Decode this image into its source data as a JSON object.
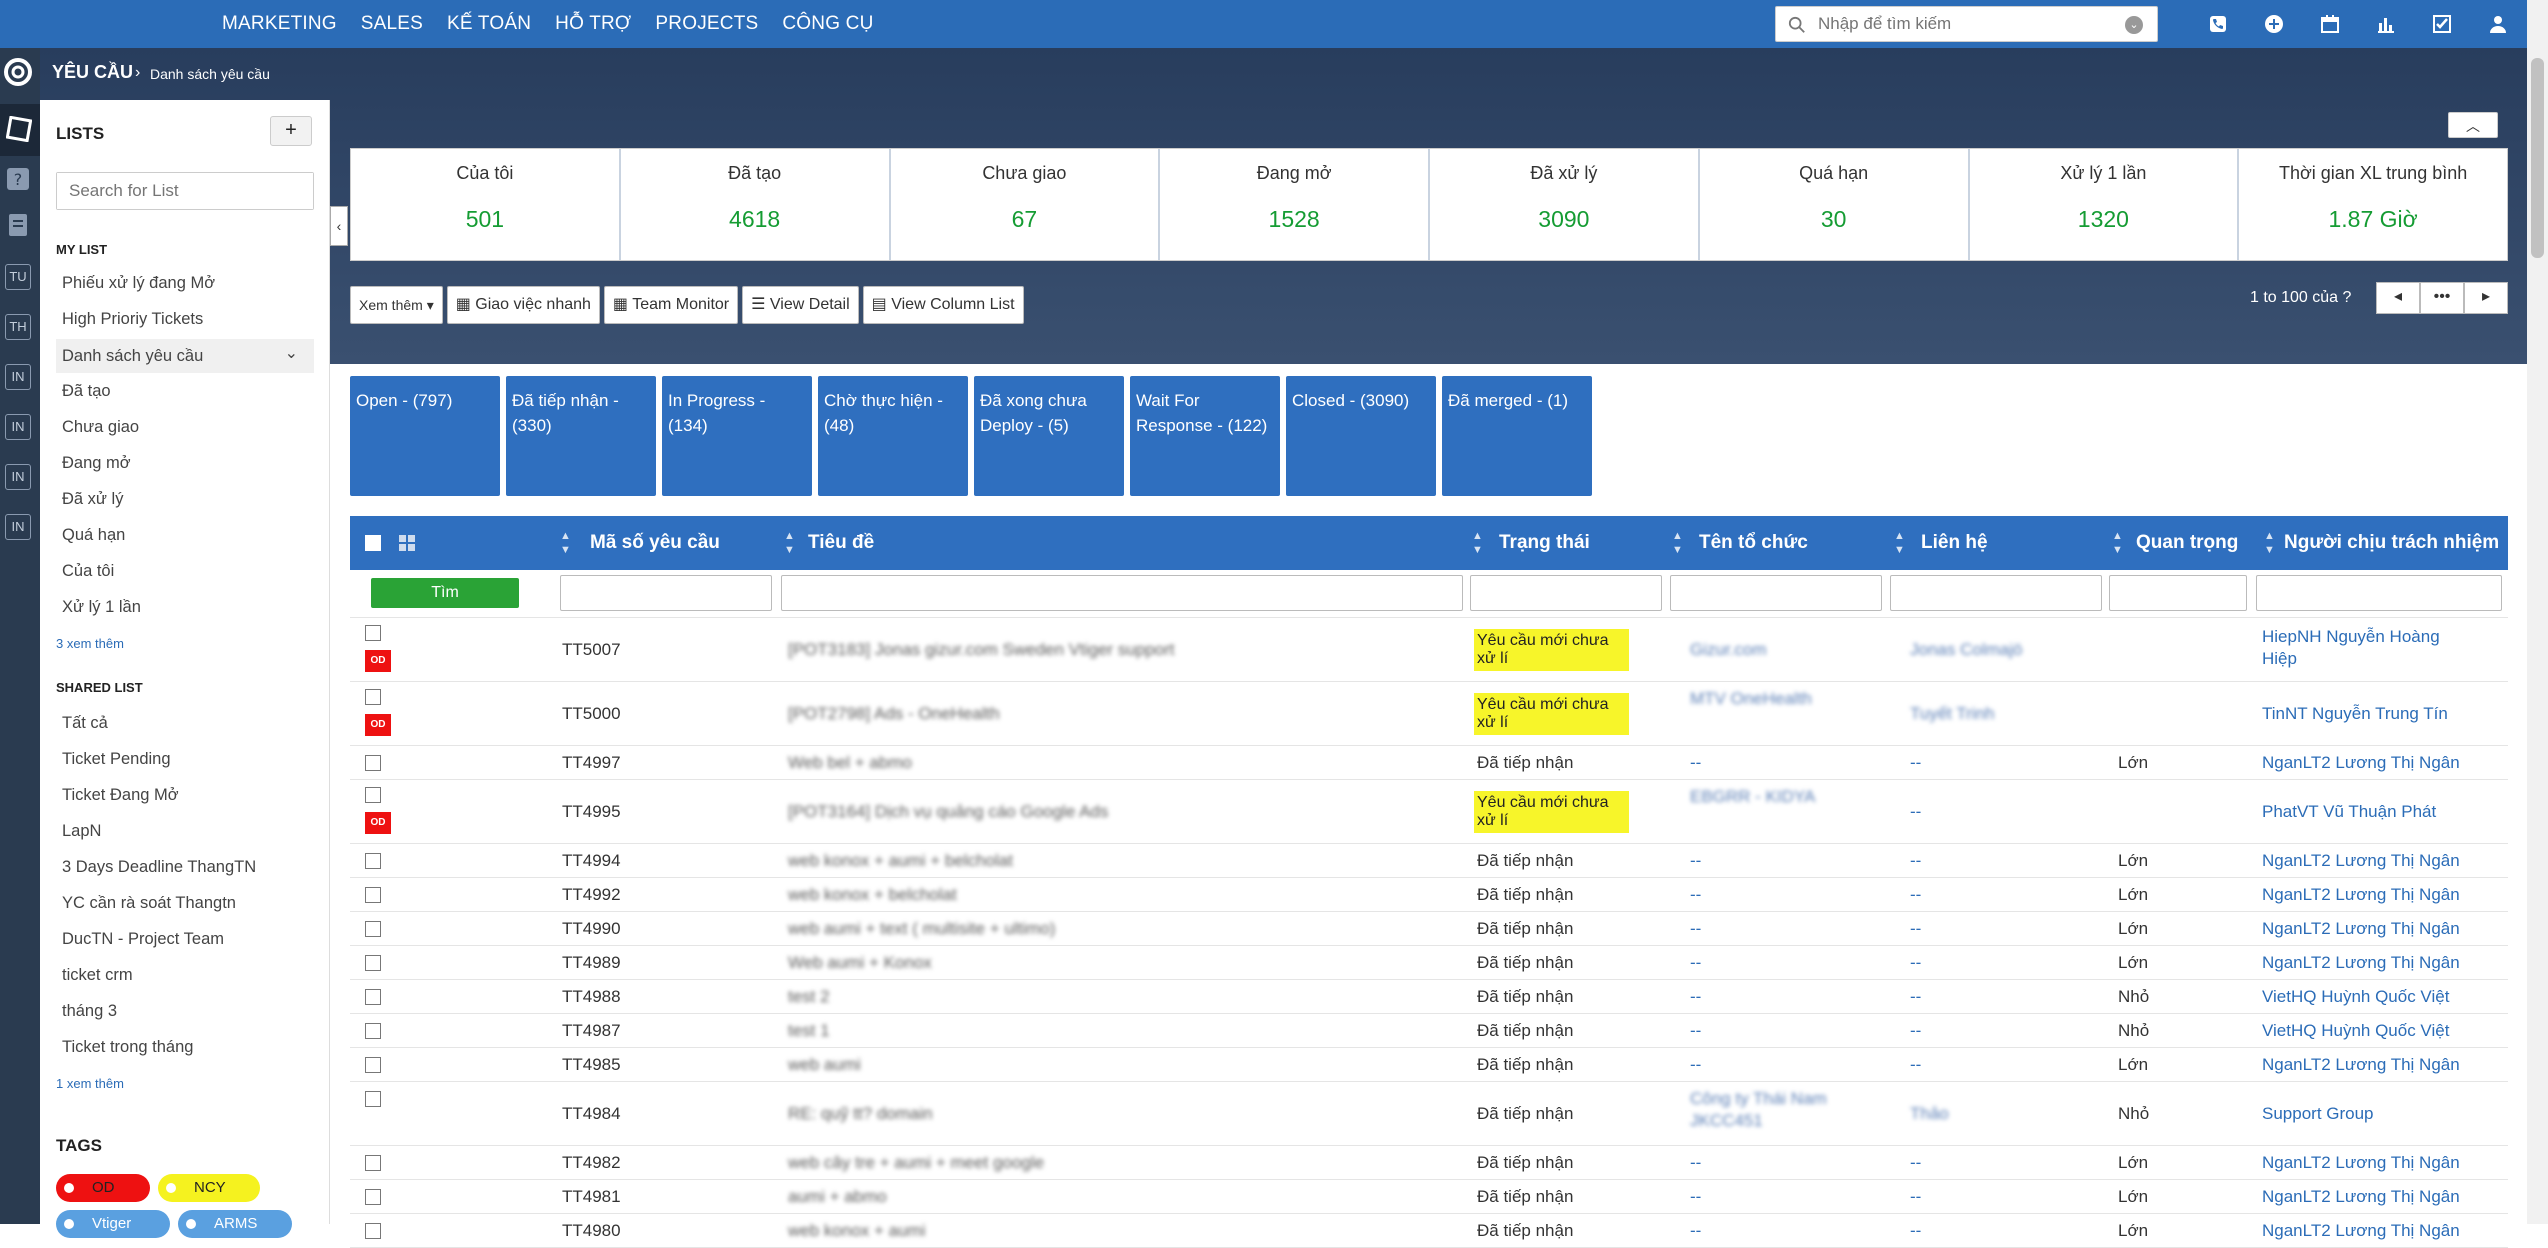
{
  "topnav": [
    "MARKETING",
    "SALES",
    "KẾ TOÁN",
    "HỖ TRỢ",
    "PROJECTS",
    "CÔNG CỤ"
  ],
  "search": {
    "placeholder": "Nhập để tìm kiếm"
  },
  "breadcrumb": {
    "section": "YÊU CẦU",
    "page": "Danh sách yêu cầu"
  },
  "leftrail": [
    "TU",
    "TH",
    "IN",
    "IN",
    "IN",
    "IN"
  ],
  "lists": {
    "title": "LISTS",
    "add": "+",
    "search_placeholder": "Search for List",
    "my_list_title": "MY LIST",
    "my_list": [
      "Phiếu xử lý đang Mở",
      "High Prioriy Tickets",
      "Danh sách yêu cầu",
      "Đã tạo",
      "Chưa giao",
      "Đang mở",
      "Đã xử lý",
      "Quá hạn",
      "Của tôi",
      "Xử lý 1 lần"
    ],
    "my_more": "3 xem thêm",
    "shared_title": "SHARED LIST",
    "shared_list": [
      "Tất cả",
      "Ticket Pending",
      "Ticket Đang Mở",
      "LapN",
      "3 Days Deadline ThangTN",
      "YC cần rà soát Thangtn",
      "DucTN - Project Team",
      "ticket crm",
      "tháng 3",
      "Ticket trong tháng"
    ],
    "shared_more": "1 xem thêm",
    "tags_title": "TAGS",
    "tags": [
      {
        "label": "OD",
        "color": "#ee1111"
      },
      {
        "label": "NCY",
        "color": "#f5f21f"
      },
      {
        "label": "Vtiger",
        "color": "#5aa0e0"
      },
      {
        "label": "ARMS",
        "color": "#5aa0e0"
      }
    ]
  },
  "stats": [
    {
      "label": "Của tôi",
      "value": "501"
    },
    {
      "label": "Đã tạo",
      "value": "4618"
    },
    {
      "label": "Chưa giao",
      "value": "67"
    },
    {
      "label": "Đang mở",
      "value": "1528"
    },
    {
      "label": "Đã xử lý",
      "value": "3090"
    },
    {
      "label": "Quá hạn",
      "value": "30"
    },
    {
      "label": "Xử lý 1 lần",
      "value": "1320"
    },
    {
      "label": "Thời gian XL trung bình",
      "value": "1.87 Giờ"
    }
  ],
  "toolbar": {
    "more": "Xem thêm ▾",
    "assign": "Giao việc nhanh",
    "team": "Team Monitor",
    "detail": "View Detail",
    "columns": "View Column List"
  },
  "pager": {
    "text": "1 to 100  của ?",
    "dots": "•••"
  },
  "status_tiles": [
    "Open - (797)",
    "Đã tiếp nhận - (330)",
    "In Progress - (134)",
    "Chờ thực hiện - (48)",
    "Đã xong chưa Deploy - (5)",
    "Wait For Response - (122)",
    "Closed - (3090)",
    "Đã merged - (1)"
  ],
  "columns": [
    "Mã số yêu cầu",
    "Tiêu đề",
    "Trạng thái",
    "Tên tổ chức",
    "Liên hệ",
    "Quan trọng",
    "Người chịu trách nhiệm"
  ],
  "filter": {
    "button": "Tìm"
  },
  "rows": [
    {
      "id": "TT5007",
      "title": "[POT3183] Jonas gizur.com Sweden Vtiger support",
      "status": "Yêu cầu mới chưa xử lí",
      "org": "Gizur.com",
      "contact": "Jonas Colmajö",
      "prio": "",
      "owner": "HiepNH Nguyễn Hoàng Hiệp",
      "od": true
    },
    {
      "id": "TT5000",
      "title": "[POT2798] Ads - OneHealth",
      "status": "Yêu cầu mới chưa xử lí",
      "org": "MTV OneHealth",
      "contact": "Tuyết Trinh",
      "prio": "",
      "owner": "TinNT Nguyễn Trung Tín",
      "od": true
    },
    {
      "id": "TT4997",
      "title": "Web bel + abmo",
      "status": "Đã tiếp nhận",
      "org": "--",
      "contact": "--",
      "prio": "Lớn",
      "owner": "NganLT2 Lương Thị Ngân",
      "od": false
    },
    {
      "id": "TT4995",
      "title": "[POT3164] Dịch vụ quảng cáo Google Ads",
      "status": "Yêu cầu mới chưa xử lí",
      "org": "EBGRR - KIDYA",
      "contact": "--",
      "prio": "",
      "owner": "PhatVT Vũ Thuận Phát",
      "od": true
    },
    {
      "id": "TT4994",
      "title": "web konox + aumi + belcholat",
      "status": "Đã tiếp nhận",
      "org": "--",
      "contact": "--",
      "prio": "Lớn",
      "owner": "NganLT2 Lương Thị Ngân",
      "od": false
    },
    {
      "id": "TT4992",
      "title": "web konox + belcholat",
      "status": "Đã tiếp nhận",
      "org": "--",
      "contact": "--",
      "prio": "Lớn",
      "owner": "NganLT2 Lương Thị Ngân",
      "od": false
    },
    {
      "id": "TT4990",
      "title": "web aumi + text ( multisite + ultimo)",
      "status": "Đã tiếp nhận",
      "org": "--",
      "contact": "--",
      "prio": "Lớn",
      "owner": "NganLT2 Lương Thị Ngân",
      "od": false
    },
    {
      "id": "TT4989",
      "title": "Web aumi + Konox",
      "status": "Đã tiếp nhận",
      "org": "--",
      "contact": "--",
      "prio": "Lớn",
      "owner": "NganLT2 Lương Thị Ngân",
      "od": false
    },
    {
      "id": "TT4988",
      "title": "test 2",
      "status": "Đã tiếp nhận",
      "org": "--",
      "contact": "--",
      "prio": "Nhỏ",
      "owner": "VietHQ Huỳnh Quốc Việt",
      "od": false
    },
    {
      "id": "TT4987",
      "title": "test 1",
      "status": "Đã tiếp nhận",
      "org": "--",
      "contact": "--",
      "prio": "Nhỏ",
      "owner": "VietHQ Huỳnh Quốc Việt",
      "od": false
    },
    {
      "id": "TT4985",
      "title": "web aumi",
      "status": "Đã tiếp nhận",
      "org": "--",
      "contact": "--",
      "prio": "Lớn",
      "owner": "NganLT2 Lương Thị Ngân",
      "od": false
    },
    {
      "id": "TT4984",
      "title": "RE: quỹ tt? domain",
      "status": "Đã tiếp nhận",
      "org": "Công ty Thái Nam JKCC451",
      "contact": "Thảo",
      "prio": "Nhỏ",
      "owner": "Support Group",
      "od": false
    },
    {
      "id": "TT4982",
      "title": "web cây tre + aumi + meet google",
      "status": "Đã tiếp nhận",
      "org": "--",
      "contact": "--",
      "prio": "Lớn",
      "owner": "NganLT2 Lương Thị Ngân",
      "od": false
    },
    {
      "id": "TT4981",
      "title": "aumi + abmo",
      "status": "Đã tiếp nhận",
      "org": "--",
      "contact": "--",
      "prio": "Lớn",
      "owner": "NganLT2 Lương Thị Ngân",
      "od": false
    },
    {
      "id": "TT4980",
      "title": "web konox + aumi",
      "status": "Đã tiếp nhận",
      "org": "--",
      "contact": "--",
      "prio": "Lớn",
      "owner": "NganLT2 Lương Thị Ngân",
      "od": false
    }
  ],
  "colors": {
    "brand": "#2b6cb7",
    "header": "#283d5d",
    "tile": "#2f6fbf",
    "stat_value": "#159c33",
    "highlight": "#f7f52a",
    "od": "#ee1111"
  }
}
